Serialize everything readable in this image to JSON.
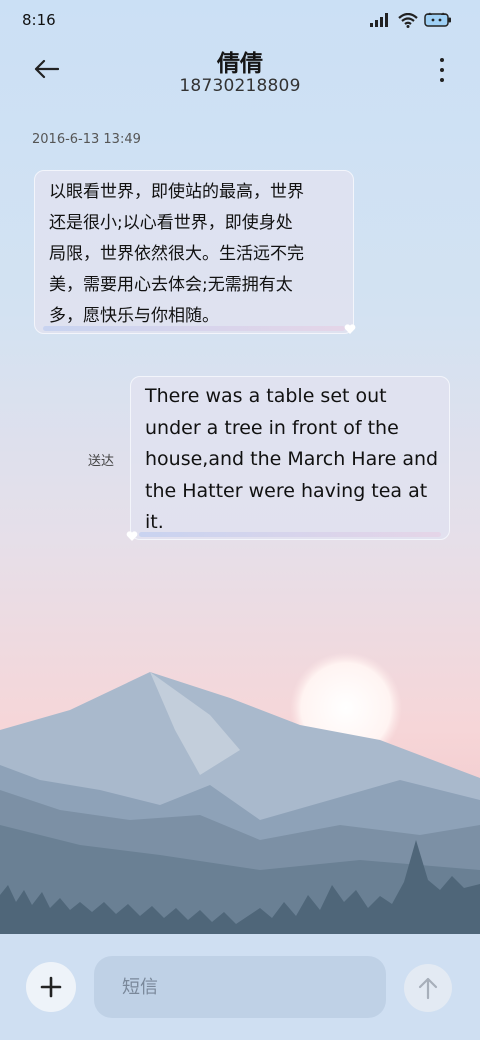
{
  "status_bar": {
    "time": "8:16",
    "icons": [
      "signal-icon",
      "wifi-icon",
      "battery-icon"
    ]
  },
  "header": {
    "contact_name": "倩倩",
    "phone_number": "18730218809",
    "icons": {
      "back": "arrow-left-icon",
      "menu": "more-vertical-icon"
    }
  },
  "conversation": {
    "timestamp": "2016-6-13 13:49",
    "messages": [
      {
        "direction": "incoming",
        "lines": [
          "以眼看世界，即使站的最高，世界",
          "还是很小;以心看世界，即使身处",
          "局限，世界依然很大。生活远不完",
          "美，需要用心去体会;无需拥有太",
          "多，愿快乐与你相随。"
        ]
      },
      {
        "direction": "outgoing",
        "status": "送达",
        "lines": [
          "There was a table set out",
          "under a tree in front of the",
          "house,and the March Hare and",
          "the Hatter were having tea at",
          "it."
        ]
      }
    ]
  },
  "composer": {
    "placeholder": "短信",
    "value": "",
    "icons": {
      "add": "plus-icon",
      "send": "arrow-up-icon"
    }
  },
  "colors": {
    "bubble_bg": "#e1e2f0",
    "bubble_border": "#f3f5fb",
    "bottom_bar": "#cfdff2",
    "input_bg": "#bfd1e6"
  }
}
